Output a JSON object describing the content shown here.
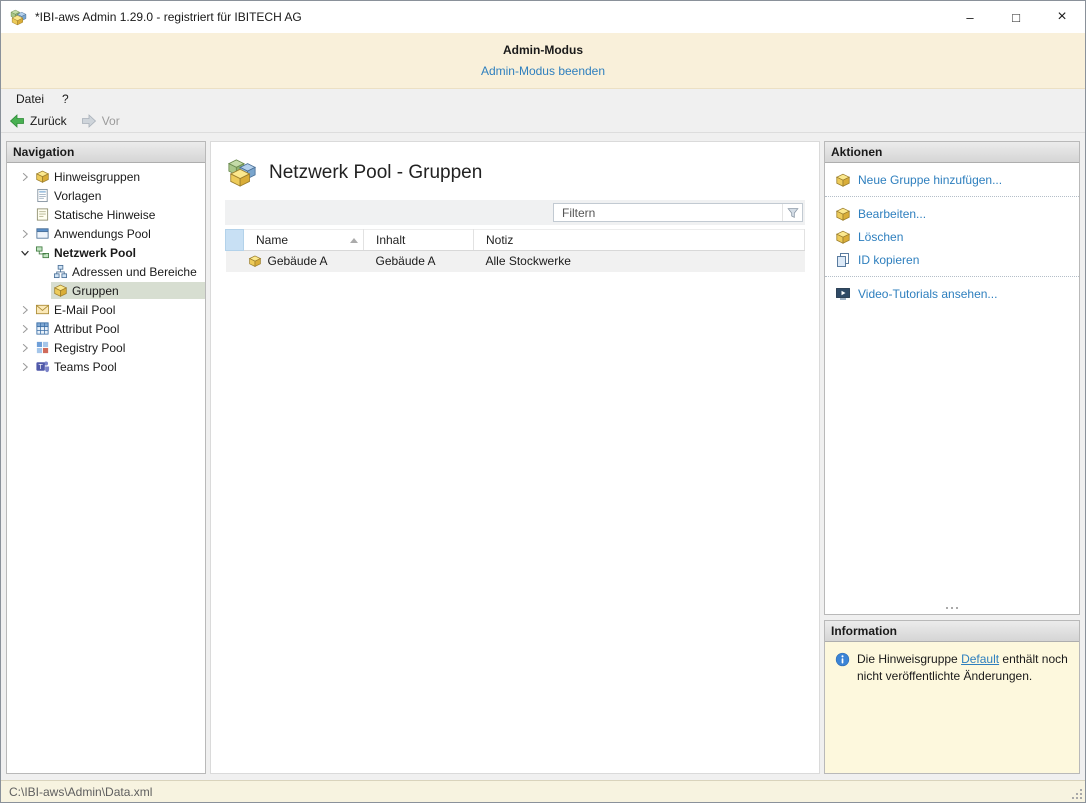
{
  "window": {
    "title": "*IBI-aws Admin 1.29.0 - registriert für IBITECH AG",
    "minimize": "–",
    "maximize": "□",
    "close": "×"
  },
  "banner": {
    "title": "Admin-Modus",
    "exit_link": "Admin-Modus beenden"
  },
  "menu": {
    "items": [
      {
        "label": "Datei"
      },
      {
        "label": "?"
      }
    ]
  },
  "toolbar": {
    "back_label": "Zurück",
    "forward_label": "Vor"
  },
  "navigation": {
    "header": "Navigation",
    "items": [
      {
        "label": "Hinweisgruppen",
        "icon": "package-icon",
        "state": "collapsed"
      },
      {
        "label": "Vorlagen",
        "icon": "template-icon"
      },
      {
        "label": "Statische Hinweise",
        "icon": "note-icon"
      },
      {
        "label": "Anwendungs Pool",
        "icon": "app-window-icon",
        "state": "collapsed"
      },
      {
        "label": "Netzwerk Pool",
        "icon": "network-icon",
        "state": "expanded"
      },
      {
        "label": "Adressen und Bereiche",
        "icon": "address-range-icon"
      },
      {
        "label": "Gruppen",
        "icon": "package-icon",
        "selected": true
      },
      {
        "label": "E-Mail Pool",
        "icon": "mail-icon",
        "state": "collapsed"
      },
      {
        "label": "Attribut Pool",
        "icon": "table-grid-icon",
        "state": "collapsed"
      },
      {
        "label": "Registry Pool",
        "icon": "registry-icon",
        "state": "collapsed"
      },
      {
        "label": "Teams Pool",
        "icon": "teams-icon",
        "state": "collapsed"
      }
    ]
  },
  "main": {
    "title": "Netzwerk Pool - Gruppen",
    "title_icon": "boxes-icon",
    "filter_placeholder": "Filtern",
    "table": {
      "columns": [
        "Name",
        "Inhalt",
        "Notiz"
      ],
      "sort": {
        "column": "Name",
        "direction": "ascending"
      },
      "rows": [
        {
          "icon": "package-icon",
          "name": "Gebäude A",
          "inhalt": "Gebäude A",
          "notiz": "Alle Stockwerke"
        }
      ]
    }
  },
  "actions": {
    "header": "Aktionen",
    "groups": [
      {
        "items": [
          {
            "label": "Neue Gruppe hinzufügen...",
            "icon": "package-add-icon"
          }
        ]
      },
      {
        "items": [
          {
            "label": "Bearbeiten...",
            "icon": "package-edit-icon"
          },
          {
            "label": "Löschen",
            "icon": "package-delete-icon"
          },
          {
            "label": "ID kopieren",
            "icon": "copy-icon"
          }
        ]
      },
      {
        "items": [
          {
            "label": "Video-Tutorials ansehen...",
            "icon": "video-icon"
          }
        ]
      }
    ]
  },
  "information": {
    "header": "Information",
    "icon": "info-icon",
    "text_before": "Die Hinweisgruppe ",
    "link_text": "Default",
    "text_after": " enthält noch nicht veröffentlichte Änderungen."
  },
  "statusbar": {
    "path": "C:\\IBI-aws\\Admin\\Data.xml"
  },
  "colors": {
    "accent_link": "#2e7fbe",
    "banner_bg": "#f9f0da",
    "info_bg": "#fdf8dd",
    "status_bg": "#f7f3e0",
    "selected_tree_bg": "#d7ded1",
    "selector_header_bg": "#c8e0f4"
  },
  "icons": {
    "app-logo-icon": "i-boxes",
    "package-icon": "i-box",
    "template-icon": "i-form",
    "note-icon": "i-note",
    "app-window-icon": "i-app",
    "network-icon": "i-network",
    "address-range-icon": "i-address",
    "mail-icon": "i-mail",
    "table-grid-icon": "i-grid",
    "registry-icon": "i-registry",
    "teams-icon": "i-teams",
    "package-add-icon": "i-box",
    "package-edit-icon": "i-box",
    "package-delete-icon": "i-box",
    "copy-icon": "i-copy",
    "video-icon": "i-video",
    "boxes-icon": "i-boxes",
    "info-icon": "i-info",
    "funnel-icon": "i-funnel",
    "back-arrow-icon": "i-arrow-left",
    "forward-arrow-icon": "i-arrow-right",
    "chevron-right-icon": "i-chev-r",
    "chevron-down-icon": "i-chev-d"
  }
}
